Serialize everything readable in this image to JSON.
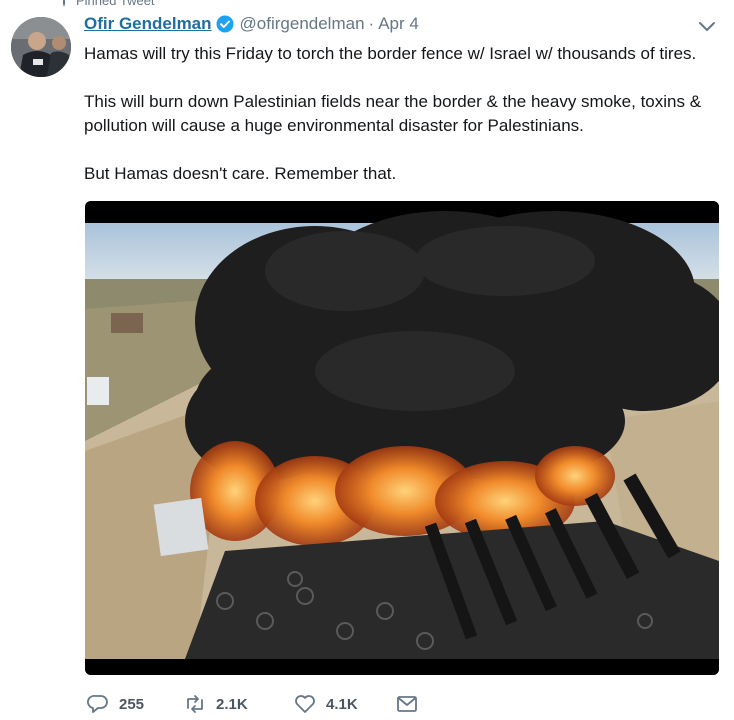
{
  "pinned_label": "Pinned Tweet",
  "author": {
    "name": "Ofir Gendelman",
    "handle": "@ofirgendelman",
    "separator": "·",
    "date": "Apr 4",
    "verified_color": "#1da1f2"
  },
  "tweet": {
    "paragraphs": [
      "Hamas will try this Friday to torch the border fence w/ Israel w/ thousands of tires.",
      "This will burn down Palestinian fields near the border & the heavy smoke, toxins & pollution will cause a huge environmental disaster for Palestinians.",
      "But Hamas doesn't care. Remember that."
    ]
  },
  "actions": {
    "replies": "255",
    "retweets": "2.1K",
    "likes": "4.1K"
  },
  "icons": {
    "pin": "pin-icon",
    "verified": "verified-badge-icon",
    "caret": "chevron-down-icon",
    "reply": "reply-icon",
    "retweet": "retweet-icon",
    "like": "heart-icon",
    "dm": "envelope-icon"
  }
}
